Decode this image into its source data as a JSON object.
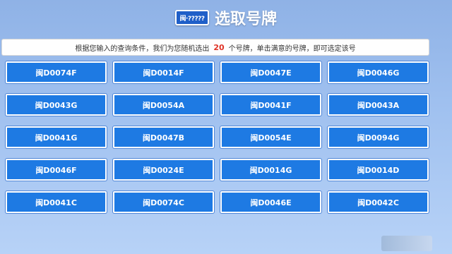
{
  "header": {
    "icon_text": "闽·?????",
    "title": "选取号牌"
  },
  "info": {
    "prefix": "根据您输入的查询条件，我们为您随机选出",
    "count": "20",
    "suffix": "个号牌，单击满意的号牌，即可选定该号"
  },
  "plates": [
    "闽D0074F",
    "闽D0014F",
    "闽D0047E",
    "闽D0046G",
    "闽D0043G",
    "闽D0054A",
    "闽D0041F",
    "闽D0043A",
    "闽D0041G",
    "闽D0047B",
    "闽D0054E",
    "闽D0094G",
    "闽D0046F",
    "闽D0024E",
    "闽D0014G",
    "闽D0014D",
    "闽D0041C",
    "闽D0074C",
    "闽D0046E",
    "闽D0042C"
  ]
}
